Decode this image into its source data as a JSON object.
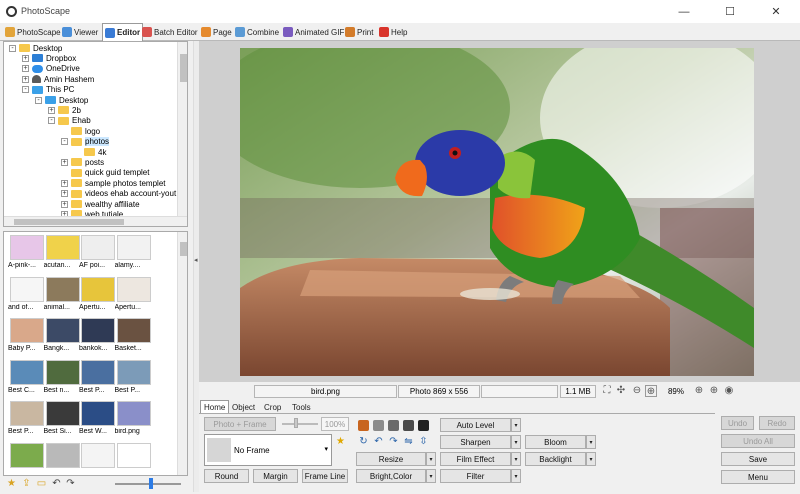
{
  "window": {
    "title": "PhotoScape",
    "controls": {
      "minimize": "—",
      "maximize": "☐",
      "close": "✕"
    }
  },
  "tabs": [
    {
      "label": "PhotoScape",
      "color": "#e2a43a"
    },
    {
      "label": "Viewer",
      "color": "#4a8fd9"
    },
    {
      "label": "Editor",
      "color": "#3a7bd5"
    },
    {
      "label": "Batch Editor",
      "color": "#d9534f"
    },
    {
      "label": "Page",
      "color": "#e58a2e"
    },
    {
      "label": "Combine",
      "color": "#5b9bd5"
    },
    {
      "label": "Animated GIF",
      "color": "#7a5bbf"
    },
    {
      "label": "Print",
      "color": "#d37b2a"
    },
    {
      "label": "Help",
      "color": "#d9342b"
    }
  ],
  "active_tab": "Editor",
  "tree": [
    {
      "label": "Desktop",
      "level": 0,
      "exp": "-",
      "icon": "folder"
    },
    {
      "label": "Dropbox",
      "level": 1,
      "exp": "+",
      "icon": "dropbox"
    },
    {
      "label": "OneDrive",
      "level": 1,
      "exp": "+",
      "icon": "cloud"
    },
    {
      "label": "Amin Hashem",
      "level": 1,
      "exp": "+",
      "icon": "user"
    },
    {
      "label": "This PC",
      "level": 1,
      "exp": "-",
      "icon": "pc"
    },
    {
      "label": "Desktop",
      "level": 2,
      "exp": "-",
      "icon": "pc"
    },
    {
      "label": "2b",
      "level": 3,
      "exp": "+",
      "icon": "folder"
    },
    {
      "label": "Ehab",
      "level": 3,
      "exp": "-",
      "icon": "folder"
    },
    {
      "label": "logo",
      "level": 4,
      "exp": "",
      "icon": "folder"
    },
    {
      "label": "photos",
      "level": 4,
      "exp": "-",
      "icon": "folder",
      "selected": true
    },
    {
      "label": "4k",
      "level": 5,
      "exp": "",
      "icon": "folder"
    },
    {
      "label": "posts",
      "level": 4,
      "exp": "+",
      "icon": "folder"
    },
    {
      "label": "quick guid templet",
      "level": 4,
      "exp": "",
      "icon": "folder"
    },
    {
      "label": "sample photos templet",
      "level": 4,
      "exp": "+",
      "icon": "folder"
    },
    {
      "label": "videos ehab account-yout",
      "level": 4,
      "exp": "+",
      "icon": "folder"
    },
    {
      "label": "wealthy affiliate",
      "level": 4,
      "exp": "+",
      "icon": "folder"
    },
    {
      "label": "web tutiale",
      "level": 4,
      "exp": "+",
      "icon": "folder"
    }
  ],
  "thumbnails": [
    {
      "caption": "A-pink-...",
      "color": "#e7c6e8"
    },
    {
      "caption": "acutan...",
      "color": "#f0d24a"
    },
    {
      "caption": "AF poi...",
      "color": "#eeeeee"
    },
    {
      "caption": "alamy....",
      "color": "#f2f2f2"
    },
    {
      "caption": "and of...",
      "color": "#f6f6f6"
    },
    {
      "caption": "animal...",
      "color": "#8c7a5c"
    },
    {
      "caption": "Apertu...",
      "color": "#e7c53b"
    },
    {
      "caption": "Apertu...",
      "color": "#ede7e0"
    },
    {
      "caption": "Baby P...",
      "color": "#d9a88a"
    },
    {
      "caption": "Bangk...",
      "color": "#3c4a66"
    },
    {
      "caption": "bankok...",
      "color": "#2f3a55"
    },
    {
      "caption": "Basket...",
      "color": "#6a5241"
    },
    {
      "caption": "Best C...",
      "color": "#5a8bb8"
    },
    {
      "caption": "Best n...",
      "color": "#506b3e"
    },
    {
      "caption": "Best P...",
      "color": "#4a6fa0"
    },
    {
      "caption": "Best P...",
      "color": "#7c9bb8"
    },
    {
      "caption": "Best P...",
      "color": "#c9b7a1"
    },
    {
      "caption": "Best Si...",
      "color": "#3a3a3a"
    },
    {
      "caption": "Best W...",
      "color": "#2b4d86"
    },
    {
      "caption": "bird.png",
      "color": "#8a8fc9"
    },
    {
      "caption": "",
      "color": "#7cab4c"
    },
    {
      "caption": "",
      "color": "#b9b9b9"
    },
    {
      "caption": "",
      "color": "#f4f4f4"
    },
    {
      "caption": "",
      "color": "#ffffff"
    }
  ],
  "status": {
    "filename": "bird.png",
    "dimensions": "Photo 869 x 556",
    "filesize": "1.1 MB",
    "zoom": "89%"
  },
  "panel_tabs": [
    "Home",
    "Object",
    "Crop",
    "Tools"
  ],
  "home": {
    "photo_frame_btn": "Photo + Frame",
    "opacity": "100%",
    "frame_select": "No Frame",
    "round_btn": "Round",
    "margin_btn": "Margin",
    "frame_line_btn": "Frame Line",
    "resize_btn": "Resize",
    "bright_color_btn": "Bright,Color",
    "auto_level_btn": "Auto Level",
    "sharpen_btn": "Sharpen",
    "film_effect_btn": "Film Effect",
    "filter_btn": "Filter",
    "bloom_btn": "Bloom",
    "backlight_btn": "Backlight"
  },
  "actions": {
    "undo": "Undo",
    "redo": "Redo",
    "undo_all": "Undo All",
    "save": "Save",
    "menu": "Menu"
  }
}
